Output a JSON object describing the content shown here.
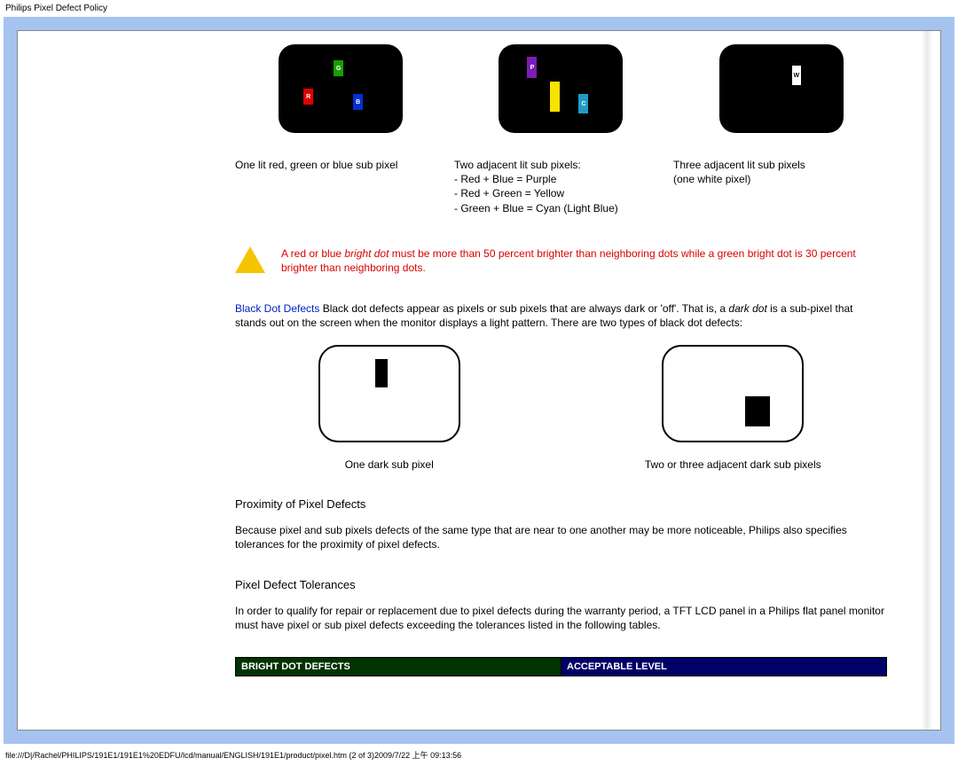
{
  "pageTitle": "Philips Pixel Defect Policy",
  "captions": {
    "c1": "One lit red, green or blue sub pixel",
    "c2_l1": "Two adjacent lit sub pixels:",
    "c2_l2": "- Red + Blue = Purple",
    "c2_l3": "- Red + Green = Yellow",
    "c2_l4": "- Green + Blue = Cyan (Light Blue)",
    "c3_l1": "Three adjacent lit sub pixels",
    "c3_l2": "(one white pixel)"
  },
  "warning": {
    "part1": "A red or blue ",
    "italic": "bright dot",
    "part2": " must be more than 50 percent brighter than neighboring dots while a green bright dot is 30 percent brighter than neighboring dots."
  },
  "blackDot": {
    "lead": "Black Dot Defects",
    "rest1": " Black dot defects appear as pixels or sub pixels that are always dark or 'off'. That is, a ",
    "italic": "dark dot",
    "rest2": " is a sub-pixel that stands out on the screen when the monitor displays a light pattern. There are two types of black dot defects:"
  },
  "darkCaptions": {
    "d1": "One dark sub pixel",
    "d2": "Two or three adjacent dark sub pixels"
  },
  "proximity": {
    "heading": "Proximity of Pixel Defects",
    "body": "Because pixel and sub pixels defects of the same type that are near to one another may be more noticeable, Philips also specifies tolerances for the proximity of pixel defects."
  },
  "tolerances": {
    "heading": "Pixel Defect Tolerances",
    "body": "In order to qualify for repair or replacement due to pixel defects during the warranty period, a TFT LCD panel in a Philips flat panel monitor must have pixel or sub pixel defects exceeding the tolerances listed in the following tables."
  },
  "table": {
    "h1": "BRIGHT DOT DEFECTS",
    "h2": "ACCEPTABLE LEVEL"
  },
  "labels": {
    "R": "R",
    "G": "G",
    "B": "B",
    "P": "P",
    "C": "C",
    "W": "W"
  },
  "footer": "file:///D|/Rachel/PHILIPS/191E1/191E1%20EDFU/lcd/manual/ENGLISH/191E1/product/pixel.htm (2 of 3)2009/7/22 上午 09:13:56"
}
